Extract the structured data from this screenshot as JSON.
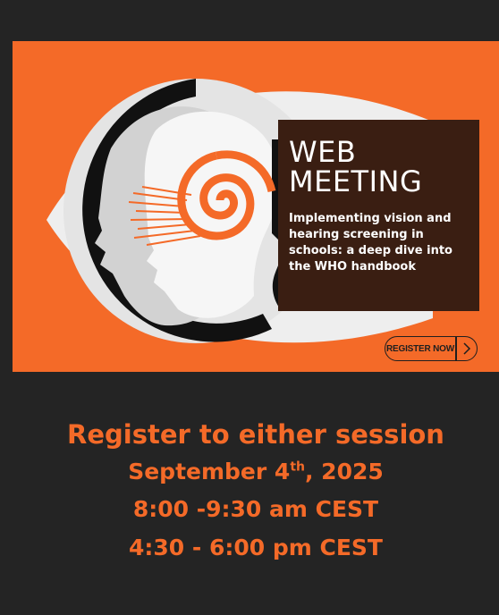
{
  "banner": {
    "title_line1": "WEB",
    "title_line2": "MEETING",
    "subtitle": "Implementing vision and hearing screening in schools: a deep dive into the WHO handbook",
    "register_button": "REGISTER NOW",
    "register_icon": "chevron-right-icon"
  },
  "session": {
    "heading": "Register to either session",
    "date_prefix": "September 4",
    "date_suffix": "th",
    "date_year": ", 2025",
    "time_1": "8:00 -9:30 am CEST",
    "time_2": "4:30 - 6:00 pm CEST"
  },
  "colors": {
    "accent": "#f46a28",
    "background_dark": "#242424",
    "info_box": "#3a1e12"
  }
}
